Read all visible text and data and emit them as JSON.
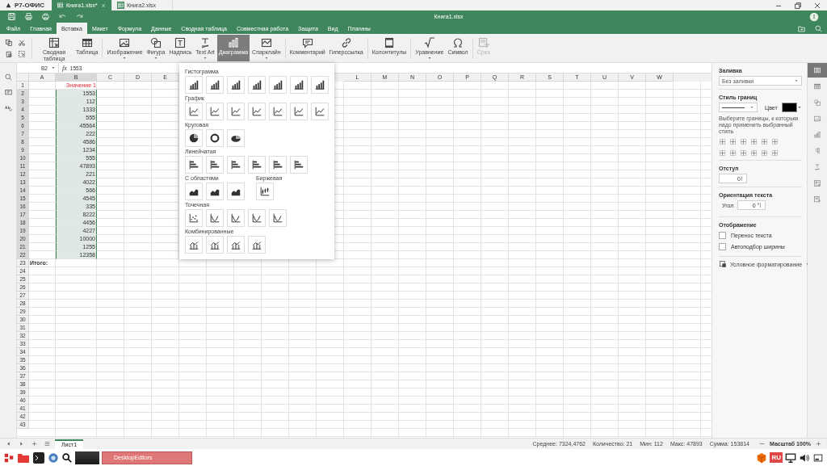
{
  "title_bar": {
    "logo": "Р7-ОФИС",
    "tabs": [
      {
        "label": "Книга1.xlsx*",
        "selected": true,
        "closable": true
      },
      {
        "label": "Книга2.xlsx",
        "selected": false,
        "closable": false
      }
    ]
  },
  "header": {
    "doc_title": "Книга1.xlsx"
  },
  "menu": [
    {
      "label": "Файл",
      "selected": false
    },
    {
      "label": "Главная",
      "selected": false
    },
    {
      "label": "Вставка",
      "selected": true
    },
    {
      "label": "Макет",
      "selected": false
    },
    {
      "label": "Формула",
      "selected": false
    },
    {
      "label": "Данные",
      "selected": false
    },
    {
      "label": "Сводная таблица",
      "selected": false
    },
    {
      "label": "Совместная работа",
      "selected": false
    },
    {
      "label": "Защита",
      "selected": false
    },
    {
      "label": "Вид",
      "selected": false
    },
    {
      "label": "Плагины",
      "selected": false
    }
  ],
  "ribbon": {
    "groups": [
      [
        {
          "kind": "pivot",
          "label": "Сводная таблица",
          "selected": false,
          "disabled": false
        },
        {
          "kind": "table",
          "label": "Таблица",
          "selected": false,
          "disabled": false
        }
      ],
      [
        {
          "kind": "image",
          "label": "Изображение",
          "caret": true,
          "selected": false,
          "disabled": false
        },
        {
          "kind": "shape",
          "label": "Фигура",
          "caret": true,
          "selected": false,
          "disabled": false
        },
        {
          "kind": "textbox",
          "label": "Надпись",
          "selected": false,
          "disabled": false
        },
        {
          "kind": "textart",
          "label": "Text Art",
          "caret": true,
          "selected": false,
          "disabled": false
        },
        {
          "kind": "chart",
          "label": "Диаграмма",
          "selected": true,
          "disabled": false
        },
        {
          "kind": "sparkline",
          "label": "Спарклайн",
          "caret": true,
          "selected": false,
          "disabled": false
        }
      ],
      [
        {
          "kind": "comment",
          "label": "Комментарий",
          "selected": false,
          "disabled": false
        },
        {
          "kind": "link",
          "label": "Гиперссылка",
          "selected": false,
          "disabled": false
        }
      ],
      [
        {
          "kind": "headerfooter",
          "label": "Колонтитулы",
          "selected": false,
          "disabled": false
        }
      ],
      [
        {
          "kind": "equation",
          "label": "Уравнение",
          "caret": true,
          "selected": false,
          "disabled": false
        },
        {
          "kind": "symbol",
          "label": "Символ",
          "selected": false,
          "disabled": false
        }
      ],
      [
        {
          "kind": "slicer",
          "label": "Срез",
          "selected": false,
          "disabled": true
        }
      ]
    ]
  },
  "formula_bar": {
    "cell": "B2",
    "fx_label": "fx",
    "value": "1553"
  },
  "sheet": {
    "columns": [
      {
        "label": "A",
        "selected": false
      },
      {
        "label": "B",
        "selected": true
      },
      {
        "label": "C",
        "selected": false
      },
      {
        "label": "D",
        "selected": false
      },
      {
        "label": "E",
        "selected": false
      },
      {
        "label": "L",
        "selected": false
      },
      {
        "label": "M",
        "selected": false
      },
      {
        "label": "N",
        "selected": false
      },
      {
        "label": "O",
        "selected": false
      },
      {
        "label": "P",
        "selected": false
      },
      {
        "label": "Q",
        "selected": false
      },
      {
        "label": "R",
        "selected": false
      },
      {
        "label": "S",
        "selected": false
      },
      {
        "label": "T",
        "selected": false
      },
      {
        "label": "U",
        "selected": false
      },
      {
        "label": "V",
        "selected": false
      },
      {
        "label": "W",
        "selected": false
      }
    ],
    "rows": [
      {
        "label": "1",
        "kind": "heading",
        "b": "Значение 1",
        "selected": false
      },
      {
        "label": "2",
        "kind": "plain",
        "b": "1553",
        "selected": true
      },
      {
        "label": "3",
        "kind": "plain",
        "b": "112",
        "selected": true
      },
      {
        "label": "4",
        "kind": "plain",
        "b": "1333",
        "selected": true
      },
      {
        "label": "5",
        "kind": "plain",
        "b": "555",
        "selected": true
      },
      {
        "label": "6",
        "kind": "plain",
        "b": "45564",
        "selected": true
      },
      {
        "label": "7",
        "kind": "plain",
        "b": "222",
        "selected": true
      },
      {
        "label": "8",
        "kind": "plain",
        "b": "4586",
        "selected": true
      },
      {
        "label": "9",
        "kind": "plain",
        "b": "1234",
        "selected": true
      },
      {
        "label": "10",
        "kind": "plain",
        "b": "555",
        "selected": true
      },
      {
        "label": "11",
        "kind": "plain",
        "b": "47893",
        "selected": true
      },
      {
        "label": "12",
        "kind": "plain",
        "b": "221",
        "selected": true
      },
      {
        "label": "13",
        "kind": "plain",
        "b": "4022",
        "selected": true
      },
      {
        "label": "14",
        "kind": "plain",
        "b": "566",
        "selected": true
      },
      {
        "label": "15",
        "kind": "plain",
        "b": "4545",
        "selected": true
      },
      {
        "label": "16",
        "kind": "plain",
        "b": "335",
        "selected": true
      },
      {
        "label": "17",
        "kind": "plain",
        "b": "8222",
        "selected": true
      },
      {
        "label": "18",
        "kind": "plain",
        "b": "4456",
        "selected": true
      },
      {
        "label": "19",
        "kind": "plain",
        "b": "4227",
        "selected": true
      },
      {
        "label": "20",
        "kind": "plain",
        "b": "10000",
        "selected": true
      },
      {
        "label": "21",
        "kind": "plain",
        "b": "1255",
        "selected": true
      },
      {
        "label": "22",
        "kind": "plain",
        "b": "12358",
        "selected": true
      },
      {
        "label": "23",
        "kind": "total",
        "a": "Итого:",
        "selected": false
      },
      {
        "label": "24",
        "selected": false
      },
      {
        "label": "25",
        "selected": false
      },
      {
        "label": "26",
        "selected": false
      },
      {
        "label": "27",
        "selected": false
      },
      {
        "label": "28",
        "selected": false
      },
      {
        "label": "29",
        "selected": false
      },
      {
        "label": "30",
        "selected": false
      },
      {
        "label": "31",
        "selected": false
      },
      {
        "label": "32",
        "selected": false
      },
      {
        "label": "33",
        "selected": false
      },
      {
        "label": "34",
        "selected": false
      },
      {
        "label": "35",
        "selected": false
      },
      {
        "label": "36",
        "selected": false
      },
      {
        "label": "37",
        "selected": false
      },
      {
        "label": "38",
        "selected": false
      },
      {
        "label": "39",
        "selected": false
      },
      {
        "label": "40",
        "selected": false
      },
      {
        "label": "41",
        "selected": false
      },
      {
        "label": "42",
        "selected": false
      },
      {
        "label": "43",
        "selected": false
      }
    ]
  },
  "chart_menu": {
    "rows": [
      [
        {
          "title": "Гистограмма",
          "items": [
            {
              "kind": "column"
            },
            {
              "kind": "column"
            },
            {
              "kind": "column"
            },
            {
              "kind": "column"
            },
            {
              "kind": "column"
            },
            {
              "kind": "column"
            },
            {
              "kind": "column"
            }
          ]
        }
      ],
      [
        {
          "title": "График",
          "items": [
            {
              "kind": "line"
            },
            {
              "kind": "line"
            },
            {
              "kind": "line"
            },
            {
              "kind": "line"
            },
            {
              "kind": "line"
            },
            {
              "kind": "line"
            },
            {
              "kind": "line"
            }
          ]
        }
      ],
      [
        {
          "title": "Круговая",
          "items": [
            {
              "kind": "pie"
            },
            {
              "kind": "doughnut"
            },
            {
              "kind": "pie3d"
            }
          ]
        }
      ],
      [
        {
          "title": "Линейчатая",
          "items": [
            {
              "kind": "bar"
            },
            {
              "kind": "bar"
            },
            {
              "kind": "bar"
            },
            {
              "kind": "bar"
            },
            {
              "kind": "bar"
            },
            {
              "kind": "bar"
            }
          ]
        }
      ],
      [
        {
          "title": "С областями",
          "items": [
            {
              "kind": "area"
            },
            {
              "kind": "area"
            },
            {
              "kind": "area"
            }
          ]
        },
        {
          "title": "Биржевая",
          "items": [
            {
              "kind": "stock"
            }
          ]
        }
      ],
      [
        {
          "title": "Точечная",
          "items": [
            {
              "kind": "scatter"
            },
            {
              "kind": "curve"
            },
            {
              "kind": "curve"
            },
            {
              "kind": "curve"
            },
            {
              "kind": "curve"
            }
          ]
        }
      ],
      [
        {
          "title": "Комбинированные",
          "items": [
            {
              "kind": "combo"
            },
            {
              "kind": "combo"
            },
            {
              "kind": "combo"
            },
            {
              "kind": "combo"
            }
          ]
        }
      ]
    ]
  },
  "format_panel": {
    "fill": {
      "label": "Заливка",
      "value": "Без заливки"
    },
    "border": {
      "label": "Стиль границ",
      "color_label": "Цвет",
      "color": "#000000",
      "hint": "Выберите границы, к которым надо применить выбранный стиль"
    },
    "indent": {
      "label": "Отступ",
      "value": "0"
    },
    "orientation": {
      "label": "Ориентация текста",
      "angle_label": "Угол",
      "value": "0 °"
    },
    "display": {
      "label": "Отображение",
      "options": [
        {
          "label": "Перенос текста",
          "checked": false
        },
        {
          "label": "Автоподбор ширины",
          "checked": false
        }
      ]
    },
    "conditional": "Условное форматирование"
  },
  "side_tabs": [
    {
      "kind": "cell",
      "selected": true
    },
    {
      "kind": "table",
      "selected": false
    },
    {
      "kind": "shape",
      "selected": false
    },
    {
      "kind": "image",
      "selected": false
    },
    {
      "kind": "chart",
      "selected": false
    },
    {
      "kind": "paragraph",
      "selected": false
    },
    {
      "kind": "textart",
      "selected": false
    },
    {
      "kind": "pivot",
      "selected": false
    },
    {
      "kind": "slicer",
      "selected": false
    }
  ],
  "status_bar": {
    "sheets": [
      {
        "label": "Лист1",
        "selected": true
      }
    ],
    "stats": [
      "Среднее: 7324,4762",
      "Количество: 21",
      "Мин: 112",
      "Макс: 47893",
      "Сумма: 153814"
    ],
    "zoom": "Масштаб 100%"
  },
  "taskbar": {
    "apps": [
      {
        "label": "DesktopEditors"
      }
    ],
    "keyboard": "RU"
  }
}
